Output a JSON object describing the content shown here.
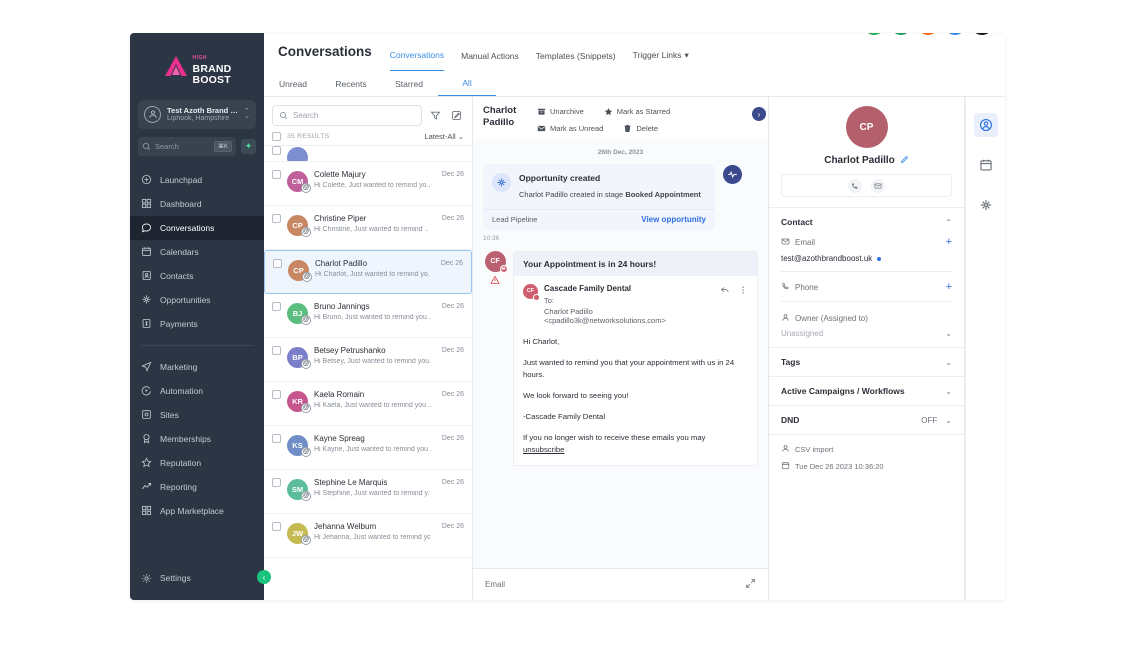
{
  "sidebar": {
    "logo": {
      "top": "HIGH",
      "line1": "BRAND",
      "line2": "BOOST"
    },
    "account": {
      "name": "Test Azoth Brand Bo..",
      "location": "Liphook, Hampshire"
    },
    "search": {
      "placeholder": "Search",
      "shortcut": "⌘K",
      "spark_icon": "sparkle-icon"
    },
    "items": [
      {
        "label": "Launchpad",
        "icon": "rocket-icon",
        "active": false
      },
      {
        "label": "Dashboard",
        "icon": "dashboard-icon",
        "active": false
      },
      {
        "label": "Conversations",
        "icon": "chat-bubble-icon",
        "active": true
      },
      {
        "label": "Calendars",
        "icon": "calendar-icon",
        "active": false
      },
      {
        "label": "Contacts",
        "icon": "contacts-icon",
        "active": false
      },
      {
        "label": "Opportunities",
        "icon": "opportunities-icon",
        "active": false
      },
      {
        "label": "Payments",
        "icon": "payments-icon",
        "active": false
      }
    ],
    "items2": [
      {
        "label": "Marketing",
        "icon": "send-icon",
        "active": false
      },
      {
        "label": "Automation",
        "icon": "automation-icon",
        "active": false
      },
      {
        "label": "Sites",
        "icon": "sites-icon",
        "active": false
      },
      {
        "label": "Memberships",
        "icon": "badge-icon",
        "active": false
      },
      {
        "label": "Reputation",
        "icon": "star-icon",
        "active": false
      },
      {
        "label": "Reporting",
        "icon": "trend-up-icon",
        "active": false
      },
      {
        "label": "App Marketplace",
        "icon": "grid-icon",
        "active": false
      }
    ],
    "settings": {
      "label": "Settings",
      "icon": "gear-icon"
    },
    "collapse_icon": "chevron-left-icon"
  },
  "header": {
    "title": "Conversations",
    "tabs": [
      {
        "label": "Conversations",
        "active": true
      },
      {
        "label": "Manual Actions",
        "active": false
      },
      {
        "label": "Templates (Snippets)",
        "active": false
      },
      {
        "label": "Trigger Links",
        "active": false,
        "caret": "▾"
      }
    ],
    "icons": [
      {
        "name": "phone-icon",
        "glyph": "✆",
        "color": "#1fae5a",
        "badge": false
      },
      {
        "name": "megaphone-icon",
        "glyph": "📣",
        "color": "#1e9e57",
        "badge": true
      },
      {
        "name": "bell-icon",
        "glyph": "🔔",
        "color": "#f36c1b",
        "badge": false
      },
      {
        "name": "help-icon",
        "glyph": "?",
        "color": "#2e8ae5",
        "badge": false
      },
      {
        "name": "user-avatar",
        "glyph": "",
        "color": "#1c1f24",
        "badge": false
      }
    ]
  },
  "subtabs": [
    {
      "label": "Unread",
      "active": false
    },
    {
      "label": "Recents",
      "active": false
    },
    {
      "label": "Starred",
      "active": false
    },
    {
      "label": "All",
      "active": true
    }
  ],
  "conversation_list": {
    "search_placeholder": "Search",
    "filter_icon": "filter-icon",
    "compose_icon": "compose-icon",
    "results_count": "35 RESULTS",
    "sort_label": "Latest-All",
    "items": [
      {
        "name": "",
        "snippet": "",
        "date": "",
        "initials": "",
        "color": "#7d8fd0",
        "partial": true,
        "selected": false
      },
      {
        "name": "Colette Majury",
        "snippet": "Hi Colette, Just wanted to remind yo..",
        "date": "Dec 26",
        "initials": "CM",
        "color": "#c0609b",
        "partial": false,
        "selected": false
      },
      {
        "name": "Christine Piper",
        "snippet": "Hi Christine, Just wanted to remind ..",
        "date": "Dec 26",
        "initials": "CP",
        "color": "#c88763",
        "partial": false,
        "selected": false
      },
      {
        "name": "Charlot Padillo",
        "snippet": "Hi Charlot, Just wanted to remind yo.",
        "date": "Dec 26",
        "initials": "CP",
        "color": "#c88763",
        "partial": false,
        "selected": true
      },
      {
        "name": "Bruno Jannings",
        "snippet": "Hi Bruno, Just wanted to remind you .",
        "date": "Dec 26",
        "initials": "BJ",
        "color": "#5bbd7f",
        "partial": false,
        "selected": false
      },
      {
        "name": "Betsey Petrushanko",
        "snippet": "Hi Betsey, Just wanted to remind you.",
        "date": "Dec 26",
        "initials": "BP",
        "color": "#7b7fc9",
        "partial": false,
        "selected": false
      },
      {
        "name": "Kaela Romain",
        "snippet": "Hi Kaela, Just wanted to remind you ..",
        "date": "Dec 26",
        "initials": "KR",
        "color": "#c5558c",
        "partial": false,
        "selected": false
      },
      {
        "name": "Kayne Spreag",
        "snippet": "Hi Kayne, Just wanted to remind you .",
        "date": "Dec 26",
        "initials": "KS",
        "color": "#6f8ec7",
        "partial": false,
        "selected": false
      },
      {
        "name": "Stephine Le Marquis",
        "snippet": "Hi Stephine, Just wanted to remind y.",
        "date": "Dec 26",
        "initials": "SM",
        "color": "#5bbd9a",
        "partial": false,
        "selected": false
      },
      {
        "name": "Jehanna Welbum",
        "snippet": "Hi Jehanna, Just wanted to remind yc",
        "date": "Dec 26",
        "initials": "JW",
        "color": "#c5bb52",
        "partial": false,
        "selected": false
      }
    ]
  },
  "thread": {
    "contact_name": "Charlot Padillo",
    "actions": [
      {
        "label": "Unarchive",
        "icon": "unarchive-icon"
      },
      {
        "label": "Mark as Starred",
        "icon": "star-filled-icon"
      },
      {
        "label": "Mark as Unread",
        "icon": "envelope-icon"
      },
      {
        "label": "Delete",
        "icon": "trash-icon"
      }
    ],
    "next_icon": "chevron-right-icon",
    "date_divider": "26th Dec, 2023",
    "opportunity": {
      "title": "Opportunity created",
      "description_pre": "Charlot Padillo created in stage ",
      "description_bold": "Booked Appointment",
      "pipeline": "Lead Pipeline",
      "link": "View opportunity",
      "icon": "opportunity-icon",
      "pulse_icon": "activity-pulse-icon"
    },
    "timestamp": "10:36",
    "message": {
      "avatar_initials": "CF",
      "warning_icon": "warning-triangle-icon",
      "subject": "Your Appointment is in 24 hours!",
      "sender": "Cascade Family Dental",
      "to_label": "To:",
      "recipient": "Charlot Padillo <cpadillo3k@networksolutions.com>",
      "reply_icon": "reply-icon",
      "more_icon": "kebab-menu-icon",
      "body": [
        "Hi Charlot,",
        "Just wanted to remind you that your appointment with us in 24 hours.",
        "We look forward to seeing you!",
        "-Cascade Family Dental"
      ],
      "footer_pre": "If you no longer wish to receive these emails you may ",
      "footer_link": "unsubscribe"
    },
    "compose": {
      "label": "Email",
      "expand_icon": "expand-icon"
    }
  },
  "contact": {
    "avatar_initials": "CP",
    "name": "Charlot Padillo",
    "edit_icon": "pencil-icon",
    "quick_actions": [
      {
        "name": "call-icon",
        "glyph": "✆"
      },
      {
        "name": "email-icon",
        "glyph": "✉"
      }
    ],
    "sections": {
      "contact_title": "Contact",
      "email_label": "Email",
      "email_value": "test@azothbrandboost.uk",
      "phone_label": "Phone",
      "owner_label": "Owner (Assigned to)",
      "owner_value": "Unassigned",
      "tags_title": "Tags",
      "campaigns_title": "Active Campaigns / Workflows",
      "dnd_title": "DND",
      "dnd_value": "OFF"
    },
    "footer": {
      "source_label": "CSV import",
      "source_icon": "person-icon",
      "date_label": "Tue Dec 26 2023 10:36:20",
      "date_icon": "calendar-icon"
    }
  },
  "rail": [
    {
      "name": "contact-panel-icon",
      "active": true
    },
    {
      "name": "calendar-panel-icon",
      "active": false
    },
    {
      "name": "opportunities-panel-icon",
      "active": false
    }
  ]
}
